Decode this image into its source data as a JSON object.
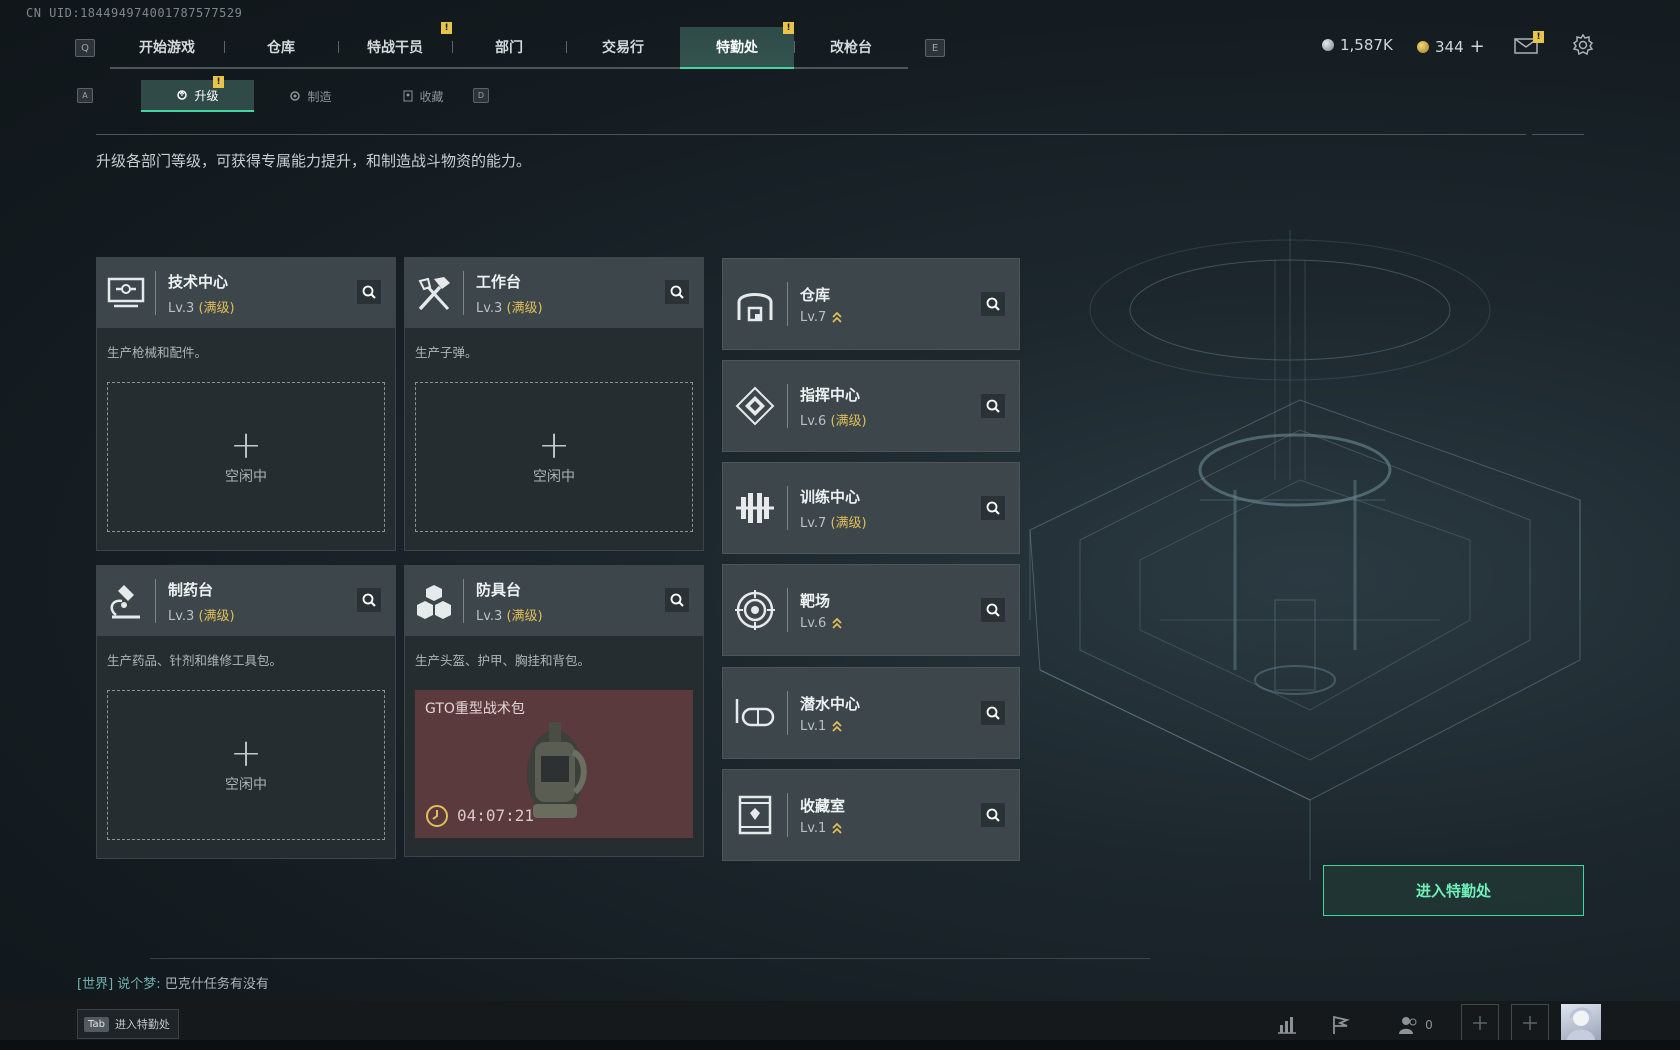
{
  "uid": "CN UID:184494974001787577529",
  "keys": {
    "prev_tab": "Q",
    "next_tab": "E",
    "prev_sub": "A",
    "next_sub": "D"
  },
  "top_tabs": [
    {
      "label": "开始游戏"
    },
    {
      "label": "仓库"
    },
    {
      "label": "特战干员",
      "badge": "!"
    },
    {
      "label": "部门"
    },
    {
      "label": "交易行"
    },
    {
      "label": "特勤处",
      "badge": "!",
      "active": true
    },
    {
      "label": "改枪台"
    }
  ],
  "sub_tabs": [
    {
      "label": "升级",
      "active": true,
      "badge": "!"
    },
    {
      "label": "制造"
    },
    {
      "label": "收藏"
    }
  ],
  "currency": {
    "silver": "1,587K",
    "gold": "344",
    "gold_plus": "+"
  },
  "mail_badge": "!",
  "description": "升级各部门等级，可获得专属能力提升，和制造战斗物资的能力。",
  "big_cards": [
    {
      "title": "技术中心",
      "level": "Lv.3",
      "max": "(满级)",
      "desc": "生产枪械和配件。",
      "slot": {
        "plus": "+",
        "idle": "空闲中"
      }
    },
    {
      "title": "工作台",
      "level": "Lv.3",
      "max": "(满级)",
      "desc": "生产子弹。",
      "slot": {
        "plus": "+",
        "idle": "空闲中"
      }
    },
    {
      "title": "制药台",
      "level": "Lv.3",
      "max": "(满级)",
      "desc": "生产药品、针剂和维修工具包。",
      "slot": {
        "plus": "+",
        "idle": "空闲中"
      }
    },
    {
      "title": "防具台",
      "level": "Lv.3",
      "max": "(满级)",
      "desc": "生产头盔、护甲、胸挂和背包。",
      "production": {
        "item": "GTO重型战术包",
        "timer": "04:07:21"
      }
    }
  ],
  "small_cards": [
    {
      "title": "仓库",
      "level": "Lv.7",
      "max": "",
      "upgradable": true
    },
    {
      "title": "指挥中心",
      "level": "Lv.6",
      "max": "(满级)",
      "upgradable": false
    },
    {
      "title": "训练中心",
      "level": "Lv.7",
      "max": "(满级)",
      "upgradable": false
    },
    {
      "title": "靶场",
      "level": "Lv.6",
      "max": "",
      "upgradable": true
    },
    {
      "title": "潜水中心",
      "level": "Lv.1",
      "max": "",
      "upgradable": true
    },
    {
      "title": "收藏室",
      "level": "Lv.1",
      "max": "",
      "upgradable": true
    }
  ],
  "enter_button": "进入特勤处",
  "chat": {
    "channel": "[世界]",
    "speaker": "说个梦:",
    "message": "巴克什任务有没有"
  },
  "tab_hint": {
    "key": "Tab",
    "label": "进入特勤处"
  },
  "friends_count": "0",
  "colors": {
    "accent": "#3fd79d",
    "max_level": "#e0bf5a",
    "badge": "#e8c54a",
    "production_bg": "#5b3a3d"
  }
}
